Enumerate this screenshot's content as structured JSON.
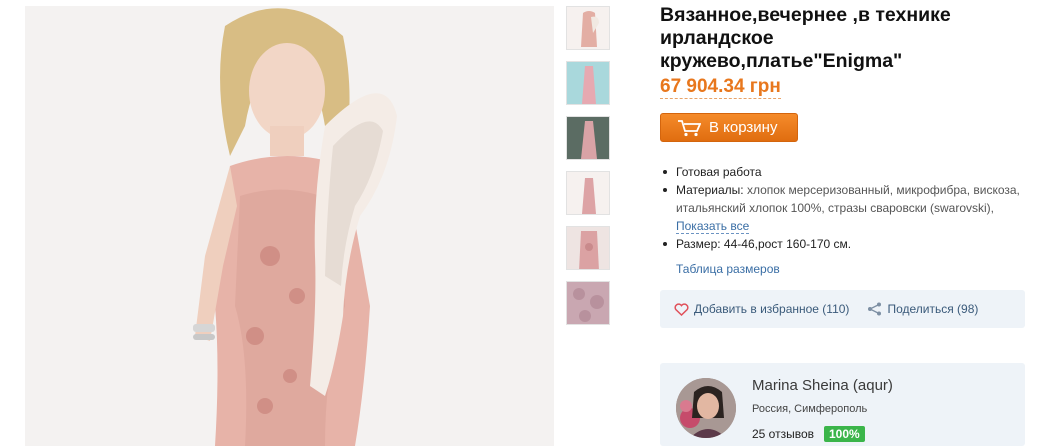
{
  "product": {
    "title": "Вязанное,вечернее ,в технике ирландское кружево,платье\"Enigma\"",
    "price": "67 904.34 грн",
    "cart_button_label": "В корзину"
  },
  "details": {
    "status": "Готовая работа",
    "materials_label": "Материалы:",
    "materials_value": "хлопок мерсеризованный, микрофибра, вискоза, итальянский хлопок 100%, стразы сваровски (swarovski),",
    "show_all_label": "Показать все",
    "size_label": "Размер:",
    "size_value": "44-46,рост 160-170 см.",
    "size_table_link": "Таблица размеров"
  },
  "actions": {
    "favorite_label": "Добавить в избранное (110)",
    "share_label": "Поделиться (98)"
  },
  "seller": {
    "name": "Marina Sheina (aqur)",
    "location": "Россия, Симферополь",
    "reviews": "25 отзывов",
    "rating_badge": "100%"
  },
  "colors": {
    "accent": "#f07d1c",
    "price": "#e8771d",
    "link": "#3a6ea5",
    "badge": "#3bb54a"
  },
  "icons": [
    "cart-icon",
    "heart-icon",
    "share-icon"
  ]
}
